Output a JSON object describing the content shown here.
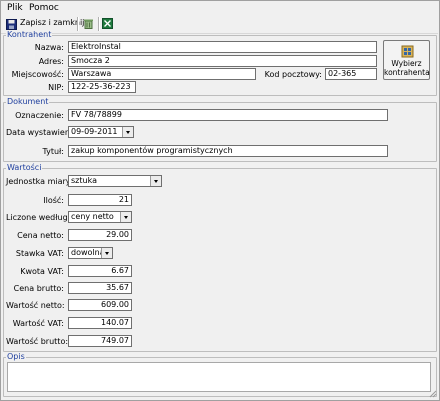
{
  "menu": {
    "file": "Plik",
    "help": "Pomoc"
  },
  "toolbar": {
    "save_close": "Zapisz i zamknij"
  },
  "contractor": {
    "group_title": "Kontrahent",
    "name_label": "Nazwa:",
    "name_value": "ElektroInstal",
    "address_label": "Adres:",
    "address_value": "Smocza 2",
    "city_label": "Miejscowość:",
    "city_value": "Warszawa",
    "postal_label": "Kod pocztowy:",
    "postal_value": "02-365",
    "nip_label": "NIP:",
    "nip_value": "122-25-36-223",
    "choose_button": "Wybierz kontrahenta"
  },
  "document": {
    "group_title": "Dokument",
    "number_label": "Oznaczenie:",
    "number_value": "FV 78/78899",
    "date_label": "Data wystawienia:",
    "date_value": "09-09-2011",
    "title_label": "Tytuł:",
    "title_value": "zakup komponentów programistycznych"
  },
  "values": {
    "group_title": "Wartości",
    "unit_label": "Jednostka miary:",
    "unit_value": "sztuka",
    "qty_label": "Ilość:",
    "qty_value": "21",
    "calc_label": "Liczone według:",
    "calc_value": "ceny netto",
    "net_price_label": "Cena netto:",
    "net_price_value": "29.00",
    "vat_rate_label": "Stawka VAT:",
    "vat_rate_value": "dowolna",
    "vat_amount_label": "Kwota VAT:",
    "vat_amount_value": "6.67",
    "gross_price_label": "Cena brutto:",
    "gross_price_value": "35.67",
    "net_value_label": "Wartość netto:",
    "net_value_value": "609.00",
    "vat_value_label": "Wartość VAT:",
    "vat_value_value": "140.07",
    "gross_value_label": "Wartość brutto:",
    "gross_value_value": "749.07"
  },
  "notes": {
    "group_title": "Opis",
    "value": ""
  }
}
